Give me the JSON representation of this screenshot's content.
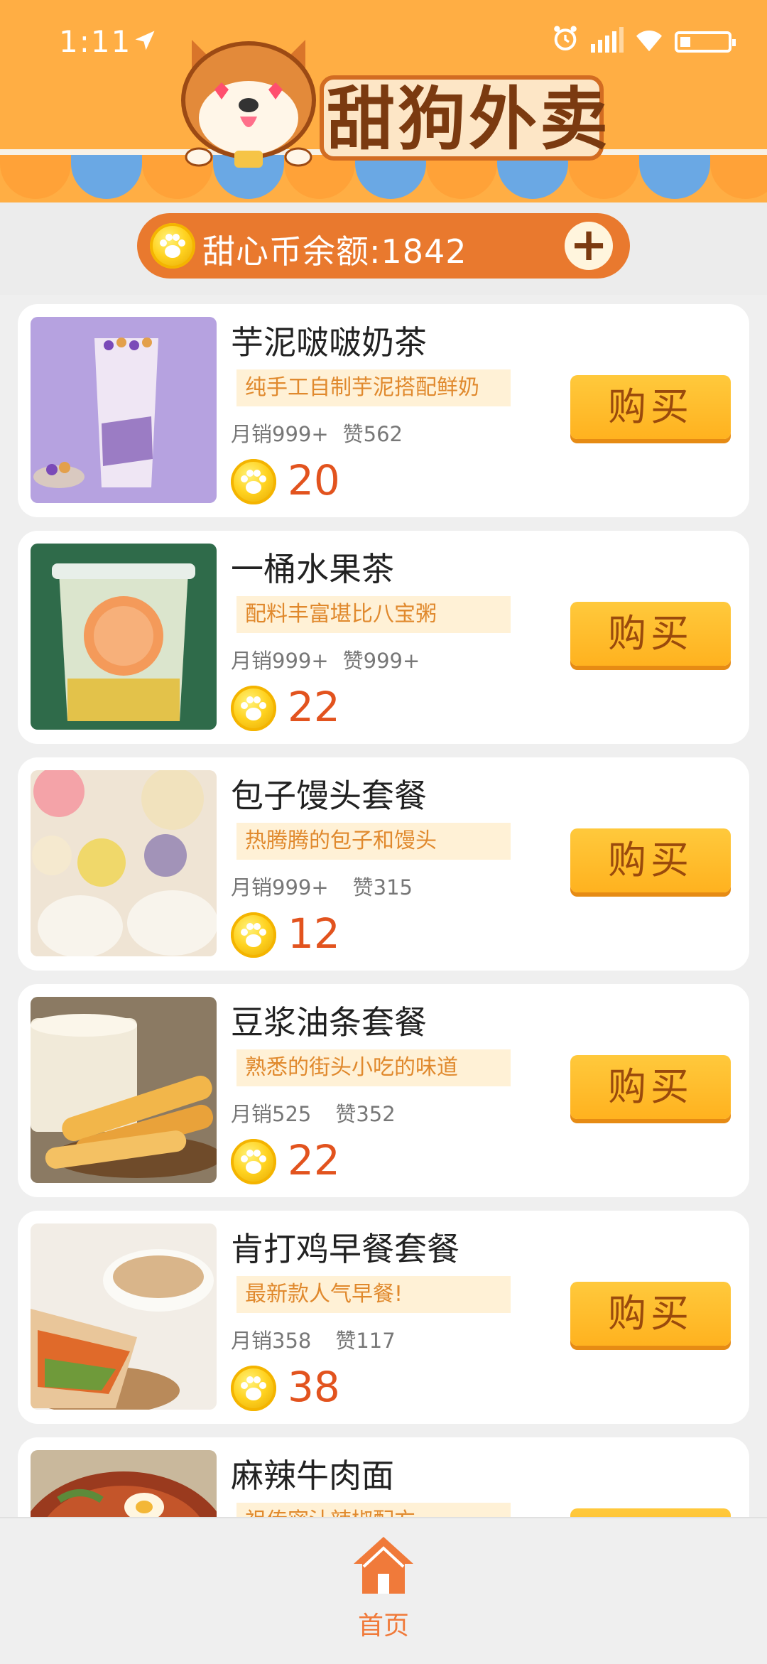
{
  "status_bar": {
    "time": "1:11"
  },
  "header": {
    "app_title": "甜狗外卖"
  },
  "balance": {
    "label": "甜心币余额:",
    "amount": "1842"
  },
  "products": [
    {
      "name": "芋泥啵啵奶茶",
      "desc": "纯手工自制芋泥搭配鲜奶",
      "sales": "月销999+",
      "likes": "赞562",
      "price": "20",
      "buy_label": "购买"
    },
    {
      "name": "一桶水果茶",
      "desc": "配料丰富堪比八宝粥",
      "sales": "月销999+",
      "likes": "赞999+",
      "price": "22",
      "buy_label": "购买"
    },
    {
      "name": "包子馒头套餐",
      "desc": "热腾腾的包子和馒头",
      "sales": "月销999+",
      "likes": "赞315",
      "price": "12",
      "buy_label": "购买"
    },
    {
      "name": "豆浆油条套餐",
      "desc": "熟悉的街头小吃的味道",
      "sales": "月销525",
      "likes": "赞352",
      "price": "22",
      "buy_label": "购买"
    },
    {
      "name": "肯打鸡早餐套餐",
      "desc": "最新款人气早餐!",
      "sales": "月销358",
      "likes": "赞117",
      "price": "38",
      "buy_label": "购买"
    },
    {
      "name": "麻辣牛肉面",
      "desc": "祖传密汁辣椒配方",
      "sales": "",
      "likes": "",
      "price": "",
      "buy_label": "购买"
    }
  ],
  "bottom_nav": {
    "home_label": "首页"
  },
  "colors": {
    "header": "#ffae44",
    "accent": "#e9792e",
    "price": "#e2531e",
    "buy_button": "#ffbb2a"
  }
}
